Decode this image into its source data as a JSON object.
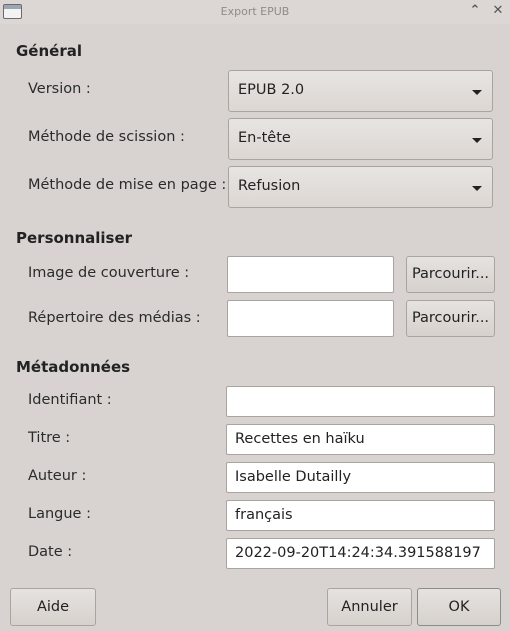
{
  "window": {
    "title": "Export EPUB"
  },
  "general": {
    "heading": "Général",
    "version": {
      "label": "Version :",
      "value": "EPUB 2.0"
    },
    "split": {
      "label": "Méthode de scission :",
      "value": "En-tête"
    },
    "layout": {
      "label": "Méthode de mise en page :",
      "value": "Refusion"
    }
  },
  "customize": {
    "heading": "Personnaliser",
    "cover": {
      "label": "Image de couverture :",
      "value": "",
      "browse_label": "Parcourir..."
    },
    "media": {
      "label": "Répertoire des médias :",
      "value": "",
      "browse_label": "Parcourir..."
    }
  },
  "metadata": {
    "heading": "Métadonnées",
    "identifier": {
      "label": "Identifiant :",
      "value": ""
    },
    "title": {
      "label": "Titre :",
      "value": "Recettes en haïku"
    },
    "author": {
      "label": "Auteur :",
      "value": "Isabelle Dutailly"
    },
    "language": {
      "label": "Langue :",
      "value": "français"
    },
    "date": {
      "label": "Date :",
      "value": "2022-09-20T14:24:34.391588197"
    }
  },
  "footer": {
    "help_label": "Aide",
    "cancel_label": "Annuler",
    "ok_label": "OK"
  },
  "icons": {
    "window": "window-icon",
    "minimize": "chevron-up-icon",
    "close": "close-icon",
    "dropdown": "chevron-down-icon"
  }
}
